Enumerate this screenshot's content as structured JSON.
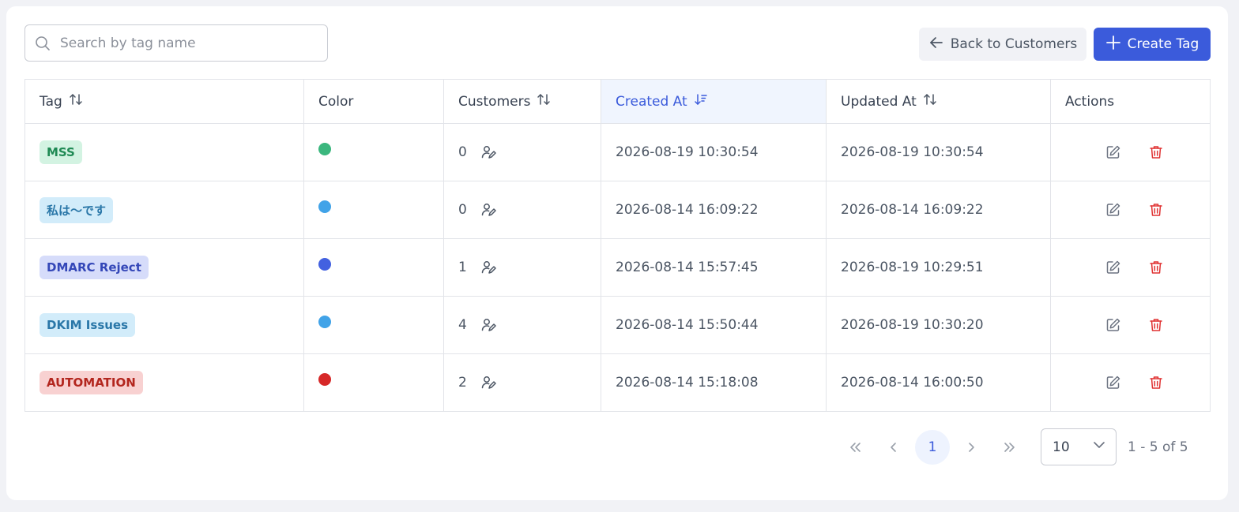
{
  "search": {
    "placeholder": "Search by tag name"
  },
  "toolbar": {
    "back_label": "Back to Customers",
    "create_label": "Create Tag"
  },
  "table": {
    "columns": [
      "Tag",
      "Color",
      "Customers",
      "Created At",
      "Updated At",
      "Actions"
    ],
    "rows": [
      {
        "tag": "MSS",
        "tag_bg": "#d3f3e2",
        "tag_fg": "#1f8a54",
        "color": "#3bb77e",
        "customers": "0",
        "created": "2026-08-19 10:30:54",
        "updated": "2026-08-19 10:30:54"
      },
      {
        "tag": "私は～です",
        "tag_bg": "#d2ecfa",
        "tag_fg": "#2a77a8",
        "color": "#41a3e8",
        "customers": "0",
        "created": "2026-08-14 16:09:22",
        "updated": "2026-08-14 16:09:22"
      },
      {
        "tag": "DMARC Reject",
        "tag_bg": "#d6dcfa",
        "tag_fg": "#3447b8",
        "color": "#4361e0",
        "customers": "1",
        "created": "2026-08-14 15:57:45",
        "updated": "2026-08-19 10:29:51"
      },
      {
        "tag": "DKIM Issues",
        "tag_bg": "#d2ecfa",
        "tag_fg": "#2a77a8",
        "color": "#41a3e8",
        "customers": "4",
        "created": "2026-08-14 15:50:44",
        "updated": "2026-08-19 10:30:20"
      },
      {
        "tag": "AUTOMATION",
        "tag_bg": "#f8d1d1",
        "tag_fg": "#b3261e",
        "color": "#d62828",
        "customers": "2",
        "created": "2026-08-14 15:18:08",
        "updated": "2026-08-14 16:00:50"
      }
    ]
  },
  "pagination": {
    "current_page": "1",
    "page_size": "10",
    "range": "1 - 5 of 5"
  },
  "colors": {
    "accent": "#3b5bdb",
    "delete": "#e03131"
  }
}
